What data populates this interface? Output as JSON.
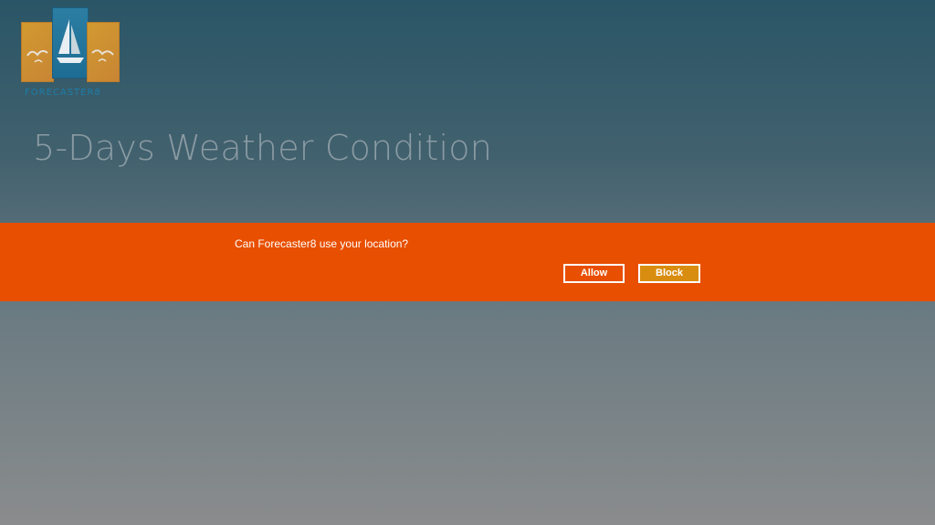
{
  "app": {
    "logo_text": "FORECASTER8",
    "title": "5-Days Weather Condition"
  },
  "permission_prompt": {
    "question": "Can Forecaster8 use your location?",
    "allow_label": "Allow",
    "block_label": "Block"
  },
  "colors": {
    "prompt_background": "#e84f00",
    "block_button": "#d98d10",
    "logo_blue": "#1d6c94",
    "logo_orange": "#d29a30"
  }
}
